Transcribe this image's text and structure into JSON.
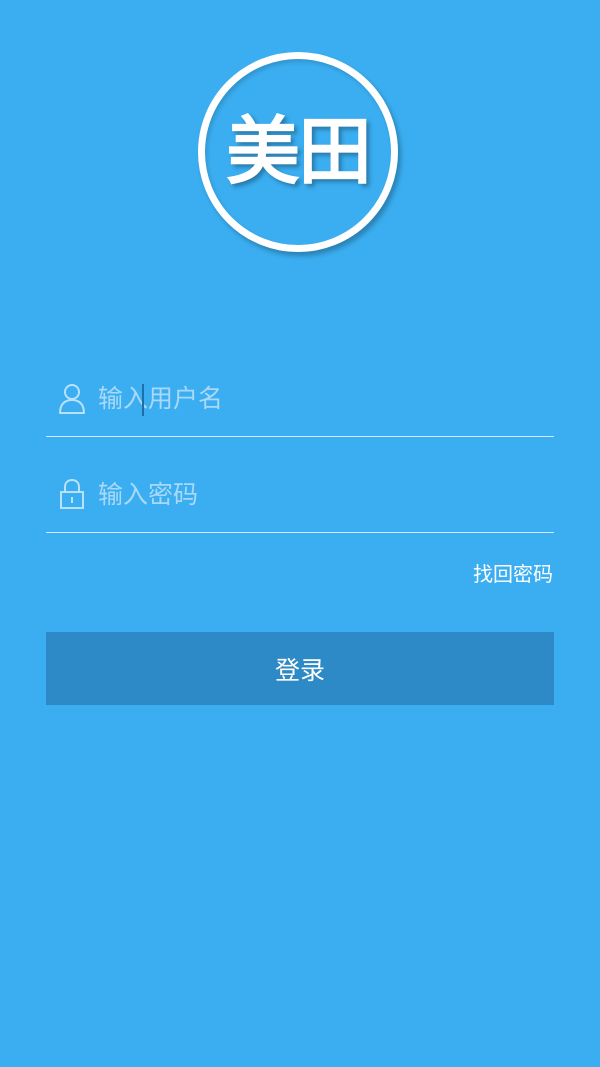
{
  "logo": {
    "text": "美田"
  },
  "form": {
    "username": {
      "value": "",
      "placeholder": "输入用户名",
      "icon": "user-icon"
    },
    "password": {
      "value": "",
      "placeholder": "输入密码",
      "icon": "lock-icon"
    },
    "forgot_label": "找回密码",
    "login_label": "登录"
  },
  "colors": {
    "background": "#3aaef1",
    "button": "#2d8ac6",
    "placeholder": "#a9d9f7"
  }
}
